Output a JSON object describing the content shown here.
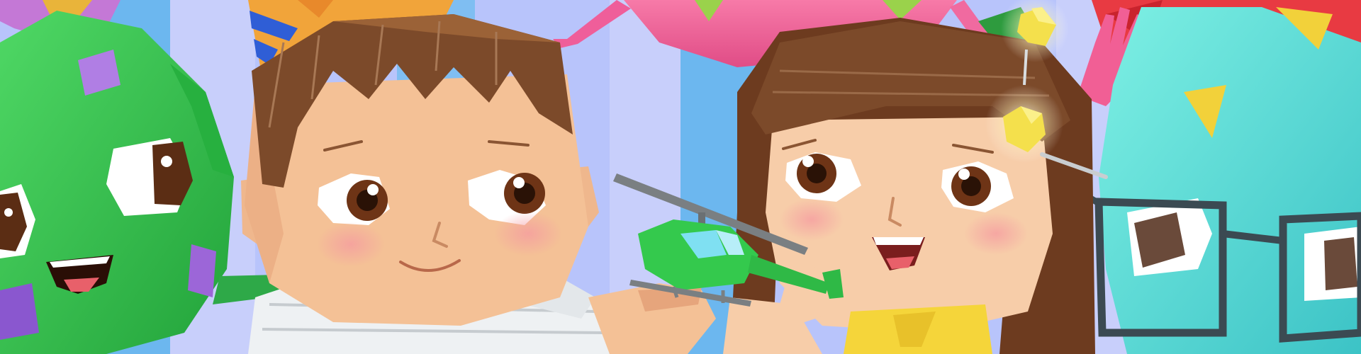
{
  "scene": {
    "kind": "illustration",
    "characters": [
      "green-monster",
      "boy",
      "girl",
      "cyan-monster-with-glasses",
      "pink-monster",
      "red-monster"
    ],
    "props": [
      "toy-helicopter",
      "party-hat",
      "magic-wand"
    ]
  },
  "colors": {
    "background_lavender": "#b8c4fb",
    "stripe_blue": "#6cb7ef",
    "stripe_lilac": "#c8cffb",
    "skin": "#f4c196",
    "skin_shadow": "#e6a57c",
    "hair_brown": "#7c4a2a",
    "hair_dark": "#5a3218",
    "green_monster": "#32c24a",
    "cyan_monster": "#56dcd2",
    "pink_monster": "#f35f98",
    "red_monster": "#e83a42",
    "helicopter_green": "#34c94d",
    "shirt_white": "#eef1f3",
    "dress_yellow": "#f5d53a",
    "wand_yellow": "#f4e04c",
    "eye_brown": "#6e3416",
    "glasses_frame": "#3b4a52"
  }
}
